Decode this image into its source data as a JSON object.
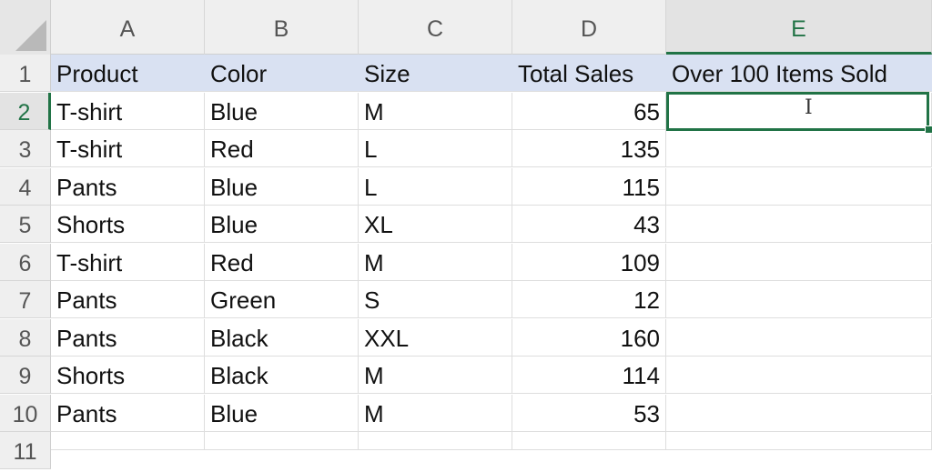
{
  "columns": [
    "A",
    "B",
    "C",
    "D",
    "E"
  ],
  "rows": [
    "1",
    "2",
    "3",
    "4",
    "5",
    "6",
    "7",
    "8",
    "9",
    "10",
    "11"
  ],
  "table": {
    "headers": [
      "Product",
      "Color",
      "Size",
      "Total Sales",
      "Over 100 Items Sold"
    ],
    "records": [
      [
        "T-shirt",
        "Blue",
        "M",
        "65",
        ""
      ],
      [
        "T-shirt",
        "Red",
        "L",
        "135",
        ""
      ],
      [
        "Pants",
        "Blue",
        "L",
        "115",
        ""
      ],
      [
        "Shorts",
        "Blue",
        "XL",
        "43",
        ""
      ],
      [
        "T-shirt",
        "Red",
        "M",
        "109",
        ""
      ],
      [
        "Pants",
        "Green",
        "S",
        "12",
        ""
      ],
      [
        "Pants",
        "Black",
        "XXL",
        "160",
        ""
      ],
      [
        "Shorts",
        "Black",
        "M",
        "114",
        ""
      ],
      [
        "Pants",
        "Blue",
        "M",
        "53",
        ""
      ]
    ]
  },
  "selection": {
    "cell": "E2",
    "active_column": "E",
    "active_row": "2"
  },
  "icons": {
    "cursor": "text-cursor-icon",
    "cursor_glyph": "I"
  },
  "colors": {
    "accent": "#217346",
    "header_fill": "#d9e1f2"
  }
}
